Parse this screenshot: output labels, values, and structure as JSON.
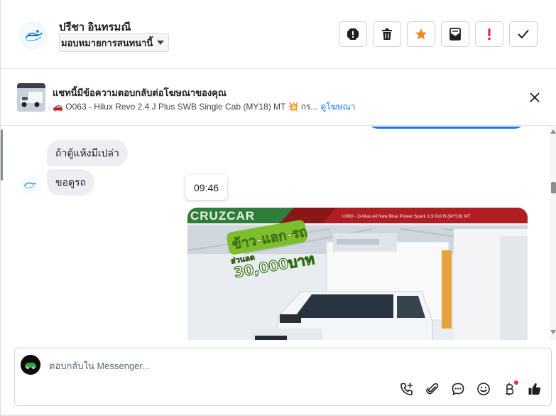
{
  "header": {
    "contact_name": "ปรีชา อินทรมณี",
    "assign_label": "มอบหมายการสนทนานี้",
    "actions": [
      {
        "name": "report-icon"
      },
      {
        "name": "trash-icon"
      },
      {
        "name": "star-icon"
      },
      {
        "name": "mark-unread-icon"
      },
      {
        "name": "important-icon"
      },
      {
        "name": "check-icon"
      }
    ]
  },
  "ad": {
    "title": "แชทนี้มีข้อความตอบกลับต่อโฆษณาของคุณ",
    "subtitle": "🚗 O063 - Hilux Revo 2.4 J Plus SWB Single Cab (MY18) MT 💥 กร...",
    "link": "ดูโฆษณา"
  },
  "messages": [
    {
      "text": "ถ้าตู้แห้งมีเปล่า"
    },
    {
      "text": "ขอดูรถ"
    }
  ],
  "timestamp": "09:46",
  "photo": {
    "banner_text": "CRUZCAR",
    "header_caption": "U080 - D-Max All New Blue Power Spark 1.9 Ddi B (MY18) MT",
    "promo_line1": "ข้าว-แลก-รถ",
    "promo_line2": "ส่วนลด",
    "promo_amount": "30,000บาท"
  },
  "composer": {
    "placeholder": "ตอบกลับใน Messenger...",
    "tools": [
      "phone-icon",
      "attachment-icon",
      "saved-reply-icon",
      "emoji-icon",
      "baht-icon",
      "like-icon"
    ]
  },
  "colors": {
    "accent": "#1877f2",
    "star": "#f5821f",
    "important": "#e41e3f",
    "badge": "#f0284a"
  }
}
